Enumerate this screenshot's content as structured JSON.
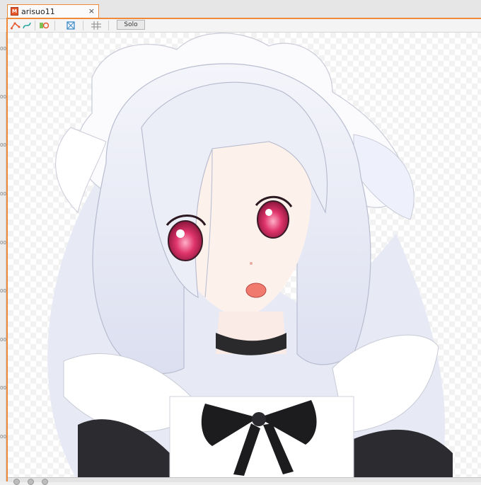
{
  "tab": {
    "title": "arisuo11",
    "close_glyph": "×",
    "icon": "model-file-icon"
  },
  "toolbar": {
    "solo_label": "Solo",
    "icons": [
      "deformer-path-icon",
      "curve-icon",
      "parameter-icon",
      "transform-icon",
      "grid-icon"
    ]
  },
  "ruler": {
    "labels": [
      "00",
      "00",
      "00",
      "00",
      "00",
      "00",
      "00",
      "00",
      "00"
    ]
  },
  "canvas": {
    "subject": "character-illustration"
  },
  "colors": {
    "accent": "#ee8a3a",
    "hair": "#e6e8f4",
    "eyes": "#c81e55",
    "ribbon": "#1c1c1e"
  }
}
